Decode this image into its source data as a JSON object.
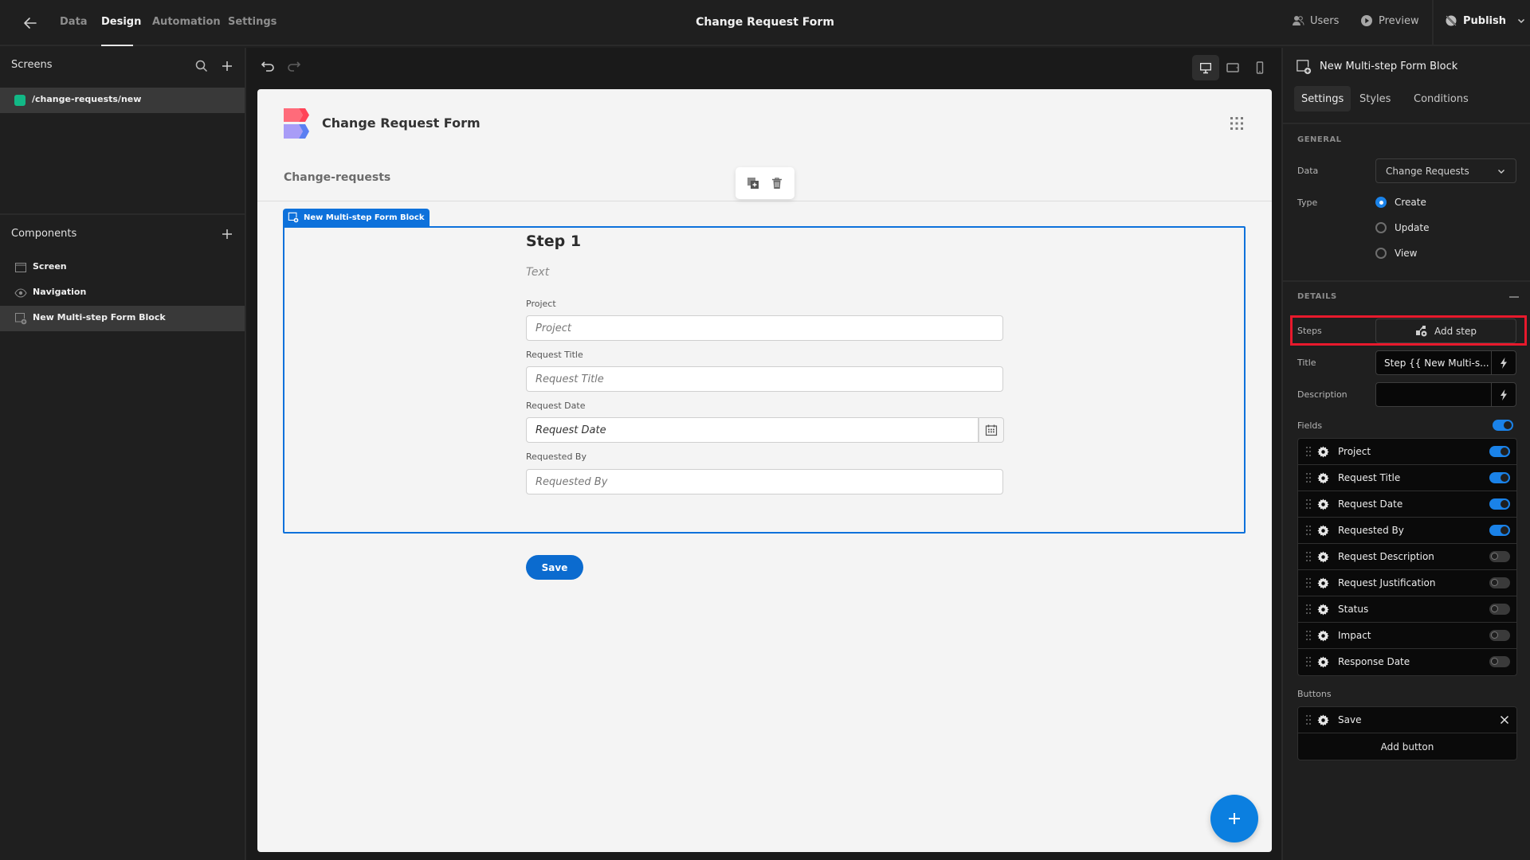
{
  "topbar": {
    "tabs": [
      {
        "label": "Data"
      },
      {
        "label": "Design",
        "active": true
      },
      {
        "label": "Automation"
      },
      {
        "label": "Settings"
      }
    ],
    "app_title": "Change Request Form",
    "users_label": "Users",
    "preview_label": "Preview",
    "publish_label": "Publish"
  },
  "left": {
    "screens_heading": "Screens",
    "screens": [
      {
        "route": "/change-requests/new",
        "color": "#12b886"
      }
    ],
    "components_heading": "Components",
    "components": [
      {
        "label": "Screen",
        "icon": "screen-icon"
      },
      {
        "label": "Navigation",
        "icon": "eye-icon"
      },
      {
        "label": "New Multi-step Form Block",
        "icon": "form-block-icon",
        "selected": true
      }
    ]
  },
  "canvas": {
    "app_name": "Change Request Form",
    "nav_link": "Change-requests",
    "block_label": "New Multi-step Form Block",
    "step_title": "Step 1",
    "step_description": "Text",
    "fields": [
      {
        "label": "Project",
        "placeholder": "Project"
      },
      {
        "label": "Request Title",
        "placeholder": "Request Title"
      },
      {
        "label": "Request Date",
        "placeholder": "Request Date",
        "type": "date"
      },
      {
        "label": "Requested By",
        "placeholder": "Requested By"
      }
    ],
    "save_label": "Save"
  },
  "right": {
    "component_title": "New Multi-step Form Block",
    "tabs": [
      {
        "label": "Settings",
        "active": true
      },
      {
        "label": "Styles"
      },
      {
        "label": "Conditions"
      }
    ],
    "general_heading": "GENERAL",
    "data_label": "Data",
    "data_value": "Change Requests",
    "type_label": "Type",
    "type_options": [
      {
        "label": "Create",
        "selected": true
      },
      {
        "label": "Update"
      },
      {
        "label": "View"
      }
    ],
    "details_heading": "DETAILS",
    "steps_label": "Steps",
    "add_step_label": "Add step",
    "title_label": "Title",
    "title_value": "Step {{ New Multi-s...",
    "description_label": "Description",
    "description_value": "",
    "fields_label": "Fields",
    "fields_all_on": true,
    "fields": [
      {
        "label": "Project",
        "on": true
      },
      {
        "label": "Request Title",
        "on": true
      },
      {
        "label": "Request Date",
        "on": true
      },
      {
        "label": "Requested By",
        "on": true
      },
      {
        "label": "Request Description",
        "on": false
      },
      {
        "label": "Request Justification",
        "on": false
      },
      {
        "label": "Status",
        "on": false
      },
      {
        "label": "Impact",
        "on": false
      },
      {
        "label": "Response Date",
        "on": false
      }
    ],
    "buttons_label": "Buttons",
    "buttons": [
      {
        "label": "Save"
      }
    ],
    "add_button_label": "Add button"
  },
  "colors": {
    "accent": "#0d71db",
    "highlight": "#e8192c",
    "toggle_on": "#1a82e8"
  }
}
